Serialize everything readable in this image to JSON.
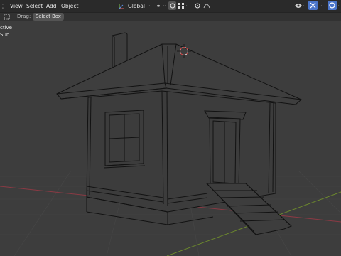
{
  "menu": {
    "view": "View",
    "select": "Select",
    "add": "Add",
    "object": "Object"
  },
  "header": {
    "transform_orientation": "Global"
  },
  "toolbar": {
    "drag_label": "Drag:",
    "drag_mode": "Select Box"
  },
  "overlay": {
    "mode_line": "ctive",
    "object_line": "Sun"
  },
  "colors": {
    "header_bg": "#2a2a2a",
    "viewport_bg": "#3d3d3d",
    "wire": "#0f0f0f",
    "grid": "#4a4a4a",
    "x_axis": "#8a3a44",
    "y_axis": "#6d8a2d",
    "accent": "#4a74c9"
  },
  "icons": {
    "menu_icon": "dot-grid-icon",
    "orientation": "global-axis-icon",
    "pivot": "link-icon",
    "snap": "magnet-icon",
    "snap_mode": "grid-snap-icon",
    "proportional": "circle-dot-icon",
    "falloff": "curve-icon",
    "gizmo": "axes-icon",
    "overlay": "overlay-icon",
    "shading": "sphere-icon"
  }
}
